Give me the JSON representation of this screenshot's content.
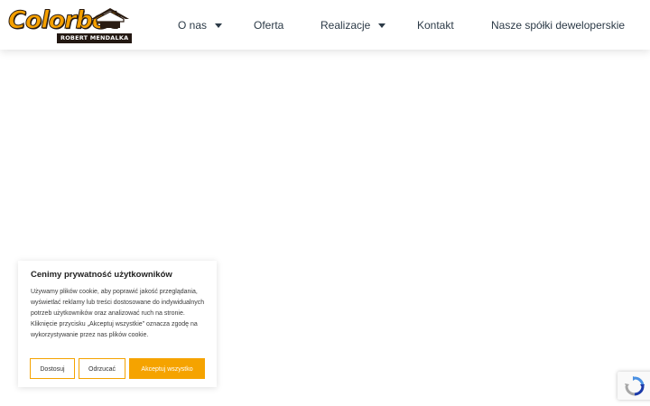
{
  "header": {
    "logo": {
      "wordmark": "Colorbet",
      "tagline": "ROBERT MENDALKA"
    },
    "nav": [
      {
        "label": "O nas",
        "has_dropdown": true
      },
      {
        "label": "Oferta",
        "has_dropdown": false
      },
      {
        "label": "Realizacje",
        "has_dropdown": true
      },
      {
        "label": "Kontakt",
        "has_dropdown": false
      },
      {
        "label": "Nasze spółki deweloperskie",
        "has_dropdown": false
      }
    ]
  },
  "cookie_banner": {
    "title": "Cenimy prywatność użytkowników",
    "text": "Używamy plików cookie, aby poprawić jakość przeglądania, wyświetlać reklamy lub treści dostosowane do indywidualnych potrzeb użytkowników oraz analizować ruch na stronie. Kliknięcie przycisku „Akceptuj wszystkie” oznacza zgodę na wykorzystywanie przez nas plików cookie.",
    "buttons": {
      "customize": "Dostosuj",
      "reject": "Odrzucać",
      "accept": "Akceptuj wszystko"
    }
  },
  "colors": {
    "accent": "#f5a300",
    "text": "#2c3a47",
    "background": "#ffffff"
  },
  "icons": {
    "recaptcha": "recaptcha-icon",
    "dropdown": "chevron-down-icon"
  }
}
